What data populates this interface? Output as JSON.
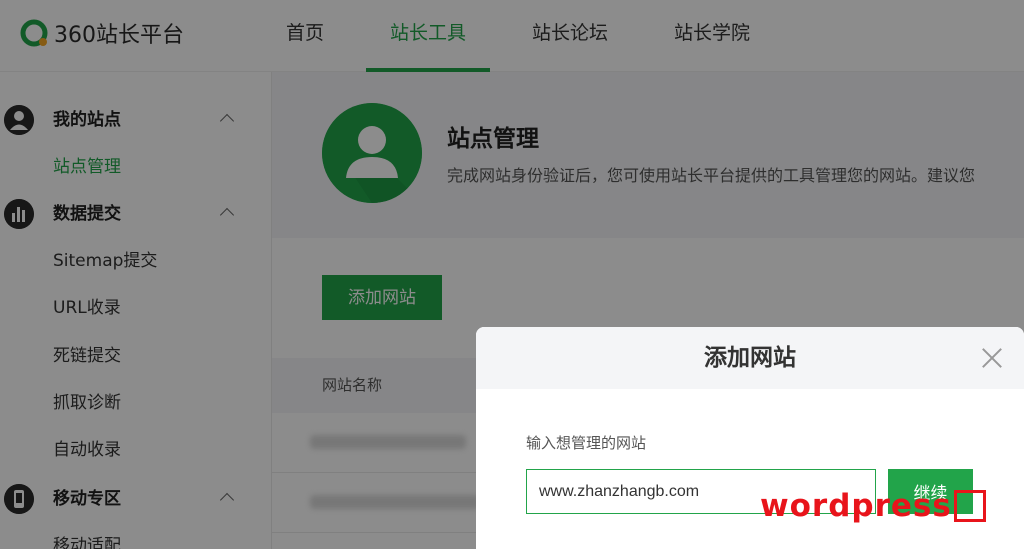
{
  "header": {
    "logo_text": "360站长平台",
    "nav": [
      {
        "label": "首页",
        "active": false
      },
      {
        "label": "站长工具",
        "active": true
      },
      {
        "label": "站长论坛",
        "active": false
      },
      {
        "label": "站长学院",
        "active": false
      }
    ]
  },
  "sidebar": {
    "groups": [
      {
        "label": "我的站点",
        "icon": "user-icon",
        "items": [
          "站点管理"
        ]
      },
      {
        "label": "数据提交",
        "icon": "bar-chart-icon",
        "items": [
          "Sitemap提交",
          "URL收录",
          "死链提交",
          "抓取诊断",
          "自动收录"
        ]
      },
      {
        "label": "移动专区",
        "icon": "mobile-icon",
        "items": [
          "移动适配"
        ]
      }
    ],
    "active_item": "站点管理"
  },
  "main": {
    "title": "站点管理",
    "description": "完成网站身份验证后，您可使用站长平台提供的工具管理您的网站。建议您",
    "add_button": "添加网站",
    "table_header": "网站名称"
  },
  "modal": {
    "title": "添加网站",
    "field_label": "输入想管理的网站",
    "input_value": "www.zhanzhangb.com",
    "continue_button": "继续"
  },
  "watermark": {
    "text": "wordpress"
  },
  "colors": {
    "accent": "#22a44a",
    "watermark": "#e8141b"
  }
}
